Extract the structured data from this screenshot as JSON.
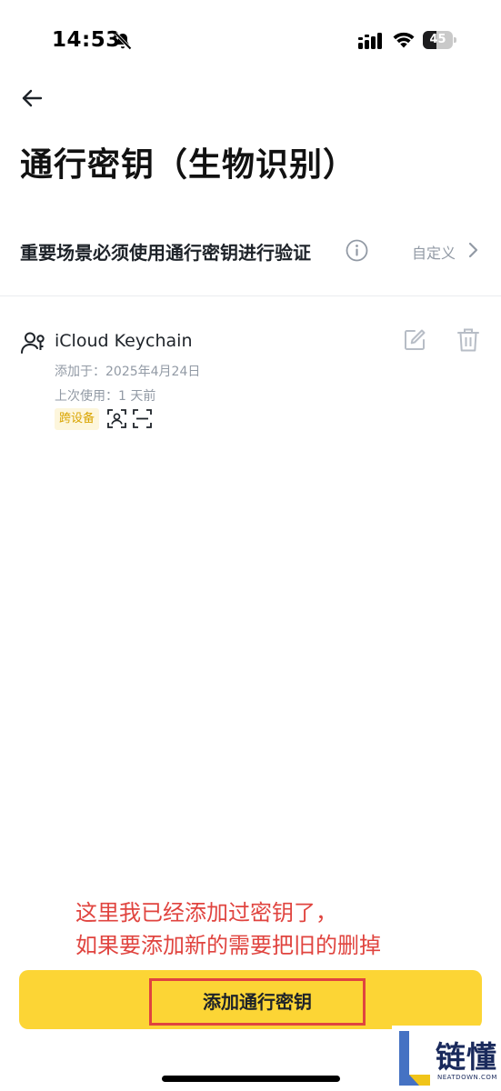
{
  "status_bar": {
    "time": "14:53",
    "battery_percent": 45,
    "battery_text": "45",
    "icons": [
      "bell-slash-icon",
      "signal-icon",
      "wifi-icon",
      "battery-icon"
    ]
  },
  "header": {
    "back_icon": "arrow-left-icon",
    "title": "通行密钥（生物识别）"
  },
  "setting": {
    "label": "重要场景必须使用通行密钥进行验证",
    "info_icon": "info-circle-icon",
    "value": "自定义",
    "chevron_icon": "chevron-right-icon"
  },
  "passkeys": [
    {
      "icon": "user-key-icon",
      "name": "iCloud Keychain",
      "added": "添加于：2025年4月24日",
      "last_used": "上次使用：1 天前",
      "badge": "跨设备",
      "feature_icons": [
        "face-id-icon",
        "scan-icon"
      ],
      "actions": [
        "edit-icon",
        "trash-icon"
      ]
    }
  ],
  "annotation": {
    "line1": "这里我已经添加过密钥了，",
    "line2": "如果要添加新的需要把旧的删掉"
  },
  "primary_button": {
    "label": "添加通行密钥"
  },
  "watermark": {
    "text": "链懂",
    "sub": "NEATDOWN.COM"
  },
  "colors": {
    "brand_yellow": "#fcd535",
    "annotation_red": "#e0443f",
    "text_primary": "#1e2329",
    "text_secondary": "#929aa5",
    "badge_text": "#d9a400",
    "badge_bg": "#fdf6dc"
  }
}
